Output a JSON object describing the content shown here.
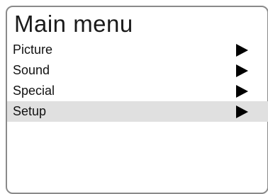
{
  "menu": {
    "title": "Main menu",
    "items": [
      {
        "label": "Picture",
        "icon": "submenu-arrow-icon",
        "selected": false
      },
      {
        "label": "Sound",
        "icon": "submenu-arrow-icon",
        "selected": false
      },
      {
        "label": "Special",
        "icon": "submenu-arrow-icon",
        "selected": false
      },
      {
        "label": "Setup",
        "icon": "submenu-arrow-icon",
        "selected": true
      }
    ]
  },
  "colors": {
    "border": "#8a8a8a",
    "selected_background": "#e0e0e0",
    "text": "#111111"
  }
}
